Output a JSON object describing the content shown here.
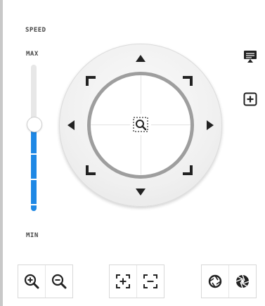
{
  "speed": {
    "title": "SPEED",
    "max_label": "MAX",
    "min_label": "MIN",
    "level": 0.56,
    "fill_color": "#1e88e5"
  },
  "ptz": {
    "directions": [
      "up",
      "up-right",
      "right",
      "down-right",
      "down",
      "down-left",
      "left",
      "up-left"
    ],
    "center_icon": "zoom-area-icon"
  },
  "side_icons": [
    "presentation-icon",
    "add-preset-icon"
  ],
  "toolbar": {
    "groups": [
      {
        "name": "zoom",
        "buttons": [
          "zoom-in-icon",
          "zoom-out-icon"
        ]
      },
      {
        "name": "focus",
        "buttons": [
          "focus-near-icon",
          "focus-far-icon"
        ]
      },
      {
        "name": "iris",
        "buttons": [
          "iris-open-icon",
          "iris-close-icon"
        ]
      }
    ]
  }
}
